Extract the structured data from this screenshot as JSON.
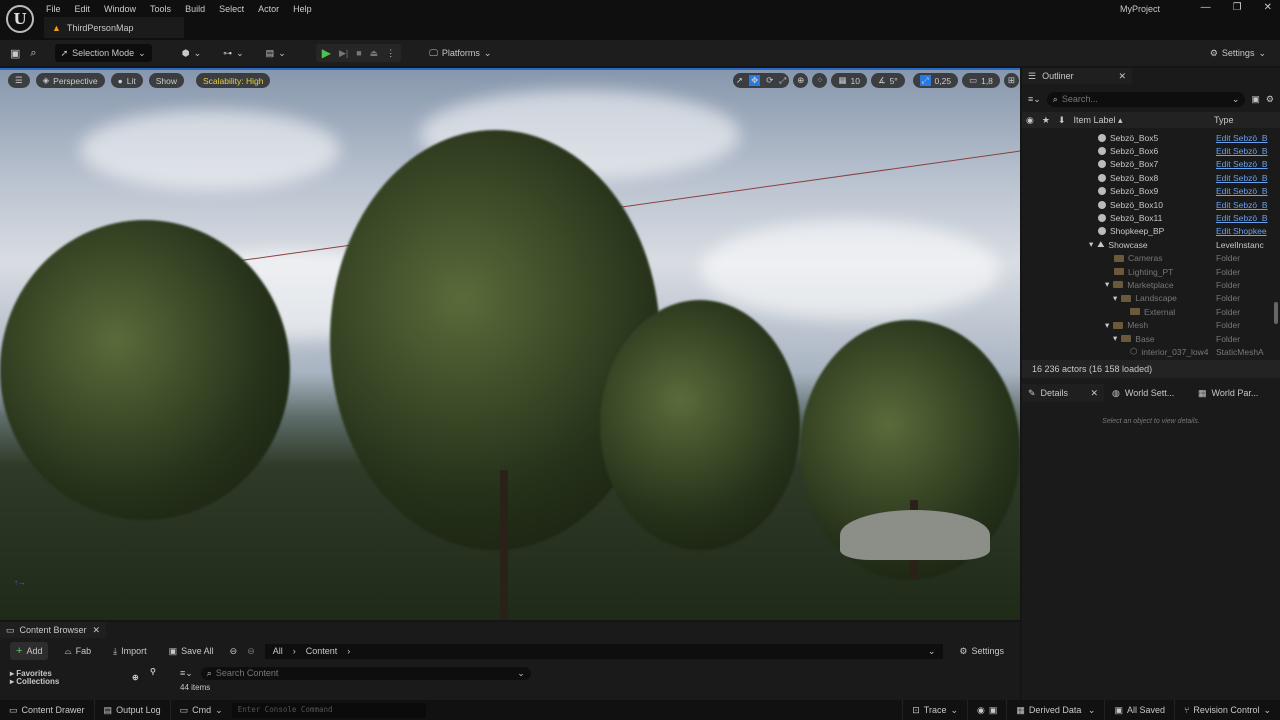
{
  "menu": [
    "File",
    "Edit",
    "Window",
    "Tools",
    "Build",
    "Select",
    "Actor",
    "Help"
  ],
  "map_tab": "ThirdPersonMap",
  "project": "MyProject",
  "window_controls": [
    "—",
    "❐",
    "✕"
  ],
  "toolbar": {
    "selection_mode": "Selection Mode",
    "platforms": "Platforms",
    "settings": "Settings"
  },
  "viewport": {
    "perspective": "Perspective",
    "lit": "Lit",
    "show": "Show",
    "scalability": "Scalability: High",
    "grid": "10",
    "angle": "5°",
    "scale": "0,25",
    "camera_speed": "1,8"
  },
  "outliner": {
    "title": "Outliner",
    "search_placeholder": "Search...",
    "col_label": "Item Label ▴",
    "col_type": "Type",
    "rows": [
      {
        "label": "Sebzö_Box5",
        "type": "Edit Sebzö_B",
        "kind": "actor",
        "indent": 0
      },
      {
        "label": "Sebzö_Box6",
        "type": "Edit Sebzö_B",
        "kind": "actor",
        "indent": 0
      },
      {
        "label": "Sebzö_Box7",
        "type": "Edit Sebzö_B",
        "kind": "actor",
        "indent": 0
      },
      {
        "label": "Sebzö_Box8",
        "type": "Edit Sebzö_B",
        "kind": "actor",
        "indent": 0
      },
      {
        "label": "Sebzö_Box9",
        "type": "Edit Sebzö_B",
        "kind": "actor",
        "indent": 0
      },
      {
        "label": "Sebzö_Box10",
        "type": "Edit Sebzö_B",
        "kind": "actor",
        "indent": 0
      },
      {
        "label": "Sebzö_Box11",
        "type": "Edit Sebzö_B",
        "kind": "actor",
        "indent": 0
      },
      {
        "label": "Shopkeep_BP",
        "type": "Edit Shopkee",
        "kind": "actor",
        "indent": 0
      },
      {
        "label": "Showcase",
        "type": "LevelInstanc",
        "kind": "level",
        "indent": 0
      },
      {
        "label": "Cameras",
        "type": "Folder",
        "kind": "folder",
        "indent": 1
      },
      {
        "label": "Lighting_PT",
        "type": "Folder",
        "kind": "folder",
        "indent": 1
      },
      {
        "label": "Marketplace",
        "type": "Folder",
        "kind": "folder",
        "indent": 1
      },
      {
        "label": "Landscape",
        "type": "Folder",
        "kind": "folder",
        "indent": 2
      },
      {
        "label": "External",
        "type": "Folder",
        "kind": "folder",
        "indent": 3
      },
      {
        "label": "Mesh",
        "type": "Folder",
        "kind": "folder",
        "indent": 1
      },
      {
        "label": "Base",
        "type": "Folder",
        "kind": "folder",
        "indent": 2
      },
      {
        "label": "interior_037_low4",
        "type": "StaticMeshA",
        "kind": "mesh",
        "indent": 3
      }
    ],
    "status": "16 236 actors (16 158 loaded)"
  },
  "details": {
    "tabs": [
      "Details",
      "World Sett...",
      "World Par..."
    ],
    "empty": "Select an object to view details."
  },
  "content_browser": {
    "title": "Content Browser",
    "add": "Add",
    "fab": "Fab",
    "import": "Import",
    "save_all": "Save All",
    "path": [
      "All",
      "Content"
    ],
    "settings": "Settings",
    "favorites": "Favorites",
    "collections": "Collections",
    "search_placeholder": "Search Content",
    "items": "44 items"
  },
  "statusbar": {
    "content_drawer": "Content Drawer",
    "output_log": "Output Log",
    "cmd": "Cmd",
    "console_placeholder": "Enter Console Command",
    "trace": "Trace",
    "derived_data": "Derived Data",
    "all_saved": "All Saved",
    "revision_control": "Revision Control"
  }
}
